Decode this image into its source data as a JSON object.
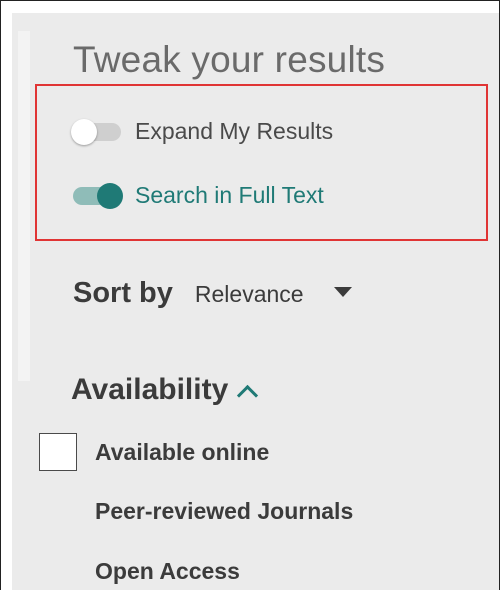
{
  "panel": {
    "heading": "Tweak your results"
  },
  "toggles": [
    {
      "label": "Expand My Results",
      "state": "off"
    },
    {
      "label": "Search in Full Text",
      "state": "on"
    }
  ],
  "sort": {
    "label": "Sort by",
    "value": "Relevance"
  },
  "availability": {
    "heading": "Availability",
    "expanded": true,
    "items": [
      {
        "label": "Available online",
        "checked": false
      },
      {
        "label": "Peer-reviewed Journals"
      },
      {
        "label": "Open Access"
      }
    ]
  },
  "colors": {
    "accent": "#1f7a76",
    "highlight_border": "#e03434",
    "panel_bg": "#ebebeb"
  },
  "icons": {
    "dropdown": "caret-down-icon",
    "collapse": "chevron-up-icon"
  }
}
